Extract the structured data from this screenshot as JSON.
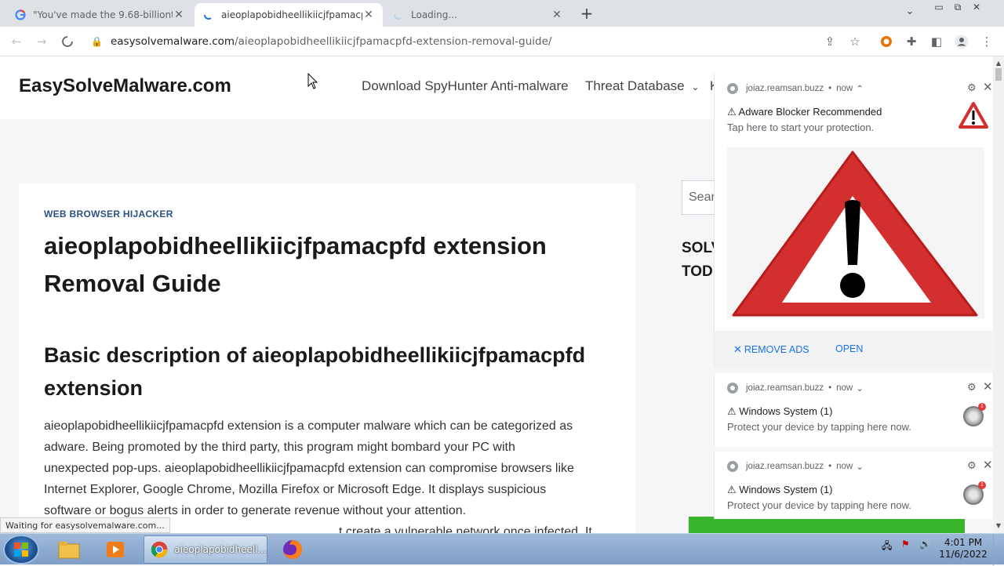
{
  "browser": {
    "tabs": [
      {
        "title": "\"You've made the 9.68-billionth s",
        "favicon": "google-icon",
        "active": false
      },
      {
        "title": "aieoplapobidheellikiicjfpamacpfd",
        "favicon": "loading-icon",
        "active": true
      },
      {
        "title": "Loading...",
        "favicon": "loading-icon",
        "active": false
      }
    ],
    "url_host": "easysolvemalware.com",
    "url_path": "/aieoplapobidheellikiicjfpamacpfd-extension-removal-guide/",
    "status_text": "Waiting for easysolvemalware.com..."
  },
  "site": {
    "logo": "EasySolveMalware.com",
    "nav": [
      {
        "label": "Download SpyHunter Anti-malware"
      },
      {
        "label": "Threat Database"
      },
      {
        "label": "K"
      }
    ],
    "search_placeholder": "Sear",
    "sidebar_title_1": "SOLV",
    "sidebar_title_2": "TOD"
  },
  "article": {
    "category": "WEB BROWSER HIJACKER",
    "title_line1": "aieoplapobidheellikiicjfpamacpfd extension",
    "title_line2": "Removal Guide",
    "h2_line1": "Basic description of aieoplapobidheellikiicjfpamacpfd",
    "h2_line2": "extension",
    "body_lines": [
      "aieoplapobidheellikiicjfpamacpfd extension is a computer malware which can be categorized as",
      "adware. Being promoted by the third party, this program might bombard your PC with",
      "unexpected pop-ups. aieoplapobidheellikiicjfpamacpfd extension can compromise browsers like",
      "Internet Explorer, Google Chrome, Mozilla Firefox or Microsoft Edge. It displays suspicious",
      "software or bogus alerts in order to generate revenue without your attention.",
      "t create a vulnerable network once infected. It"
    ]
  },
  "notifications": [
    {
      "source": "joiaz.reamsan.buzz",
      "time": "now",
      "chevron": "⌃",
      "title": "⚠ Adware Blocker Recommended",
      "body": "Tap here to start your protection.",
      "remove_label": "REMOVE ADS",
      "open_label": "OPEN"
    },
    {
      "source": "joiaz.reamsan.buzz",
      "time": "now",
      "chevron": "⌄",
      "title": "⚠ Windows System (1)",
      "body": "Protect your device by tapping here now.",
      "badge": "1"
    },
    {
      "source": "joiaz.reamsan.buzz",
      "time": "now",
      "chevron": "⌄",
      "title": "⚠ Windows System (1)",
      "body": "Protect your device by tapping here now.",
      "badge": "1"
    }
  ],
  "taskbar": {
    "chrome_label": "aieoplapobidheell...",
    "time": "4:01 PM",
    "date": "11/6/2022"
  },
  "colors": {
    "accent_link": "#1a73e8",
    "category": "#2c5282",
    "warning_red": "#d32f2f",
    "green": "#38b52a"
  }
}
